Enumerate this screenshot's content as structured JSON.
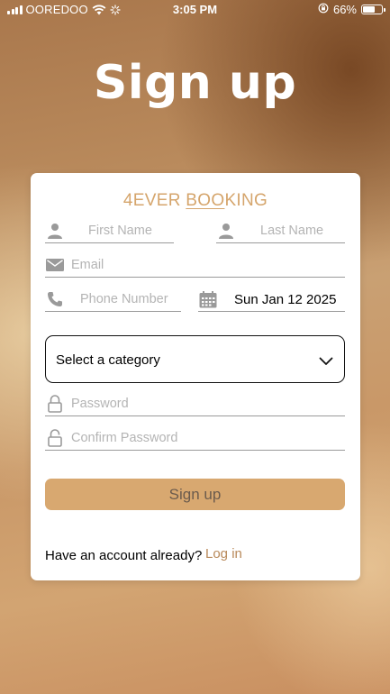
{
  "status_bar": {
    "carrier": "OOREDOO",
    "time": "3:05 PM",
    "battery": "66%",
    "battery_level": 0.66
  },
  "page": {
    "title": "Sign up"
  },
  "card": {
    "brand": {
      "part1": "4EVER ",
      "part2": "BOO",
      "part3": "KING"
    },
    "first_name": {
      "placeholder": "First Name",
      "icon": "person-icon"
    },
    "last_name": {
      "placeholder": "Last Name",
      "icon": "person-icon"
    },
    "email": {
      "placeholder": "Email",
      "icon": "envelope-icon"
    },
    "phone": {
      "placeholder": "Phone Number",
      "icon": "phone-icon"
    },
    "date": {
      "value": "Sun Jan 12 2025",
      "icon": "calendar-icon"
    },
    "category": {
      "selected": "Select a category",
      "icon": "chevron-down-icon"
    },
    "password": {
      "placeholder": "Password",
      "icon": "lock-icon"
    },
    "confirm_password": {
      "placeholder": "Confirm Password",
      "icon": "unlock-icon"
    },
    "signup_button": "Sign up",
    "footer_text": "Have an account already?",
    "login_link": "Log in"
  },
  "colors": {
    "accent": "#d5a56c",
    "button_bg": "#d8a870",
    "button_text": "#6b5b4d",
    "link": "#b8895a"
  }
}
